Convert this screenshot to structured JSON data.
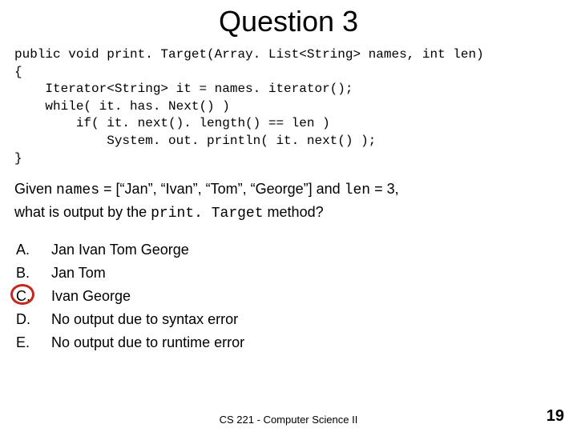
{
  "title": "Question 3",
  "code": "public void print. Target(Array. List<String> names, int len)\n{\n    Iterator<String> it = names. iterator();\n    while( it. has. Next() )\n        if( it. next(). length() == len )\n            System. out. println( it. next() );\n}",
  "prompt": {
    "pre1": "Given ",
    "names_var": "names",
    "mid1": " = [“Jan”, “Ivan”, “Tom”, “George”]  and ",
    "len_var": "len",
    "mid2": " = 3,",
    "line2_pre": "what is output by the ",
    "method": "print. Target",
    "line2_post": " method?"
  },
  "options": [
    {
      "letter": "A.",
      "text": "Jan Ivan Tom George",
      "circled": false
    },
    {
      "letter": "B.",
      "text": "Jan Tom",
      "circled": false
    },
    {
      "letter": "C.",
      "text": "Ivan George",
      "circled": true
    },
    {
      "letter": "D.",
      "text": "No output due to syntax error",
      "circled": false
    },
    {
      "letter": "E.",
      "text": "No output due to runtime error",
      "circled": false
    }
  ],
  "footer": "CS 221 - Computer Science II",
  "page_number": "19",
  "chart_data": null
}
